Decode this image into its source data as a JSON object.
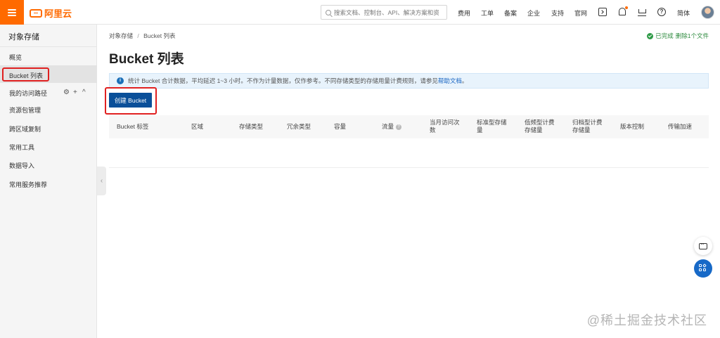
{
  "header": {
    "logo_text": "阿里云",
    "search_placeholder": "搜索文档、控制台、API、解决方案和资源",
    "nav": [
      "费用",
      "工单",
      "备案",
      "企业",
      "支持",
      "官网"
    ],
    "lang": "简体"
  },
  "sidebar": {
    "title": "对象存储",
    "items": [
      "概览",
      "Bucket 列表",
      "我的访问路径",
      "资源包管理",
      "跨区域复制",
      "常用工具",
      "数据导入",
      "常用服务推荐"
    ]
  },
  "main": {
    "breadcrumb": [
      "对象存储",
      "Bucket 列表"
    ],
    "breadcrumb_sep": "/",
    "status_text": "已完成",
    "status_link": "删除1个文件",
    "page_title": "Bucket 列表",
    "notice_text": "统计 Bucket 合计数据，平均延迟 1~3 小时。不作为计量数据，仅作参考。不同存储类型的存储用量计费规则，请参见",
    "notice_link": "帮助文档",
    "notice_end": "。",
    "create_button": "创建 Bucket",
    "columns": [
      "Bucket 标签",
      "区域",
      "存储类型",
      "冗余类型",
      "容量",
      "流量",
      "当月访问次数",
      "标准型存储量",
      "低频型计费存储量",
      "归档型计费存储量",
      "版本控制",
      "传输加速"
    ]
  },
  "watermark": "@稀土掘金技术社区",
  "colors": {
    "brand": "#ff6a00",
    "primary_button": "#0a4f99",
    "highlight_box": "#e02020"
  }
}
